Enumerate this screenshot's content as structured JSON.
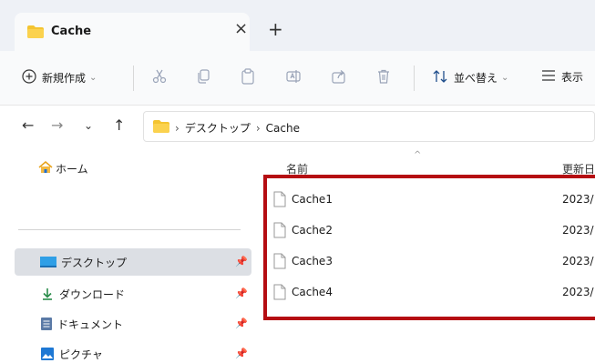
{
  "tab": {
    "title": "Cache",
    "close": "×",
    "new_tab": "+"
  },
  "toolbar": {
    "new_label": "新規作成",
    "sort_label": "並べ替え",
    "view_label": "表示"
  },
  "address": {
    "segments": [
      "デスクトップ",
      "Cache"
    ],
    "separator": "›"
  },
  "sidebar": {
    "home": "ホーム",
    "items": [
      {
        "label": "デスクトップ",
        "pinned": true,
        "selected": true
      },
      {
        "label": "ダウンロード",
        "pinned": true,
        "selected": false
      },
      {
        "label": "ドキュメント",
        "pinned": true,
        "selected": false
      },
      {
        "label": "ピクチャ",
        "pinned": true,
        "selected": false
      }
    ]
  },
  "columns": {
    "name": "名前",
    "date": "更新日"
  },
  "files": [
    {
      "name": "Cache1",
      "date": "2023/"
    },
    {
      "name": "Cache2",
      "date": "2023/"
    },
    {
      "name": "Cache3",
      "date": "2023/"
    },
    {
      "name": "Cache4",
      "date": "2023/"
    }
  ],
  "colors": {
    "highlight": "#b50d12",
    "folder": "#f4c430",
    "accent": "#0067c0"
  }
}
